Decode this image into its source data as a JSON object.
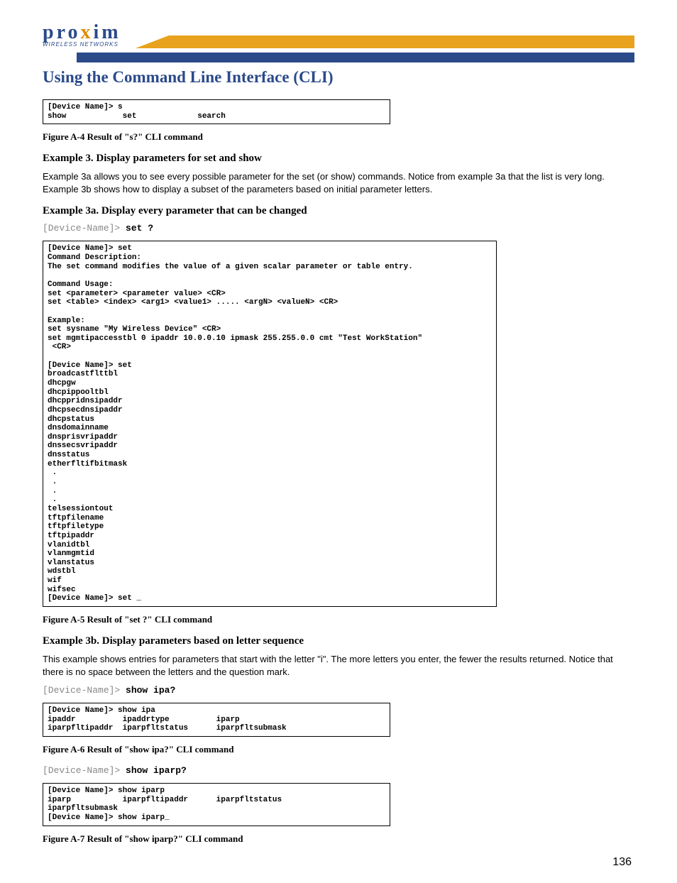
{
  "logo": {
    "brand_letters": "pro",
    "brand_x": "x",
    "brand_tail": "im",
    "subtitle": "WIRELESS NETWORKS"
  },
  "title": "Using the Command Line Interface (CLI)",
  "box_a4": "[Device Name]> s\nshow            set             search",
  "cap_a4": "Figure A-4    Result of \"s?\" CLI command",
  "ex3_heading": "Example 3. Display parameters for set and show",
  "ex3_body": "Example 3a allows you to see every possible parameter for the set (or show) commands. Notice from example 3a that the list is very long. Example 3b shows how to display a subset of the parameters based on initial parameter letters.",
  "ex3a_heading": "Example 3a. Display every parameter that can be changed",
  "ex3a_prompt_prefix": "[Device-Name]>",
  "ex3a_prompt_cmd": "set ?",
  "box_a5": "[Device Name]> set\nCommand Description:\nThe set command modifies the value of a given scalar parameter or table entry.\n\nCommand Usage:\nset <parameter> <parameter value> <CR>\nset <table> <index> <arg1> <value1> ..... <argN> <valueN> <CR>\n\nExample:\nset sysname \"My Wireless Device\" <CR>\nset mgmtipaccesstbl 0 ipaddr 10.0.0.10 ipmask 255.255.0.0 cmt \"Test WorkStation\"\n <CR>\n\n[Device Name]> set\nbroadcastflttbl\ndhcpgw\ndhcpippooltbl\ndhcppridnsipaddr\ndhcpsecdnsipaddr\ndhcpstatus\ndnsdomainname\ndnsprisvripaddr\ndnssecsvripaddr\ndnsstatus\netherfltifbitmask\n .\n .\n .\n .\ntelsessiontout\ntftpfilename\ntftpfiletype\ntftpipaddr\nvlanidtbl\nvlanmgmtid\nvlanstatus\nwdstbl\nwif\nwifsec\n[Device Name]> set _",
  "cap_a5": "Figure A-5    Result of \"set ?\" CLI command",
  "ex3b_heading": "Example 3b. Display parameters based on letter sequence",
  "ex3b_body": "This example shows entries for parameters that start with the letter \"i\". The more letters you enter, the fewer the results returned. Notice that there is no space between the letters and the question mark.",
  "ex3b_prompt1_prefix": "[Device-Name]>",
  "ex3b_prompt1_cmd": "show ipa?",
  "box_a6": "[Device Name]> show ipa\nipaddr          ipaddrtype          iparp\niparpfltipaddr  iparpfltstatus      iparpfltsubmask",
  "cap_a6": "Figure A-6    Result of \"show ipa?\" CLI command",
  "ex3b_prompt2_prefix": "[Device-Name]>",
  "ex3b_prompt2_cmd": "show iparp?",
  "box_a7": "[Device Name]> show iparp\niparp           iparpfltipaddr      iparpfltstatus\niparpfltsubmask\n[Device Name]> show iparp_",
  "cap_a7": "Figure A-7    Result of \"show iparp?\" CLI command",
  "page_number": "136"
}
